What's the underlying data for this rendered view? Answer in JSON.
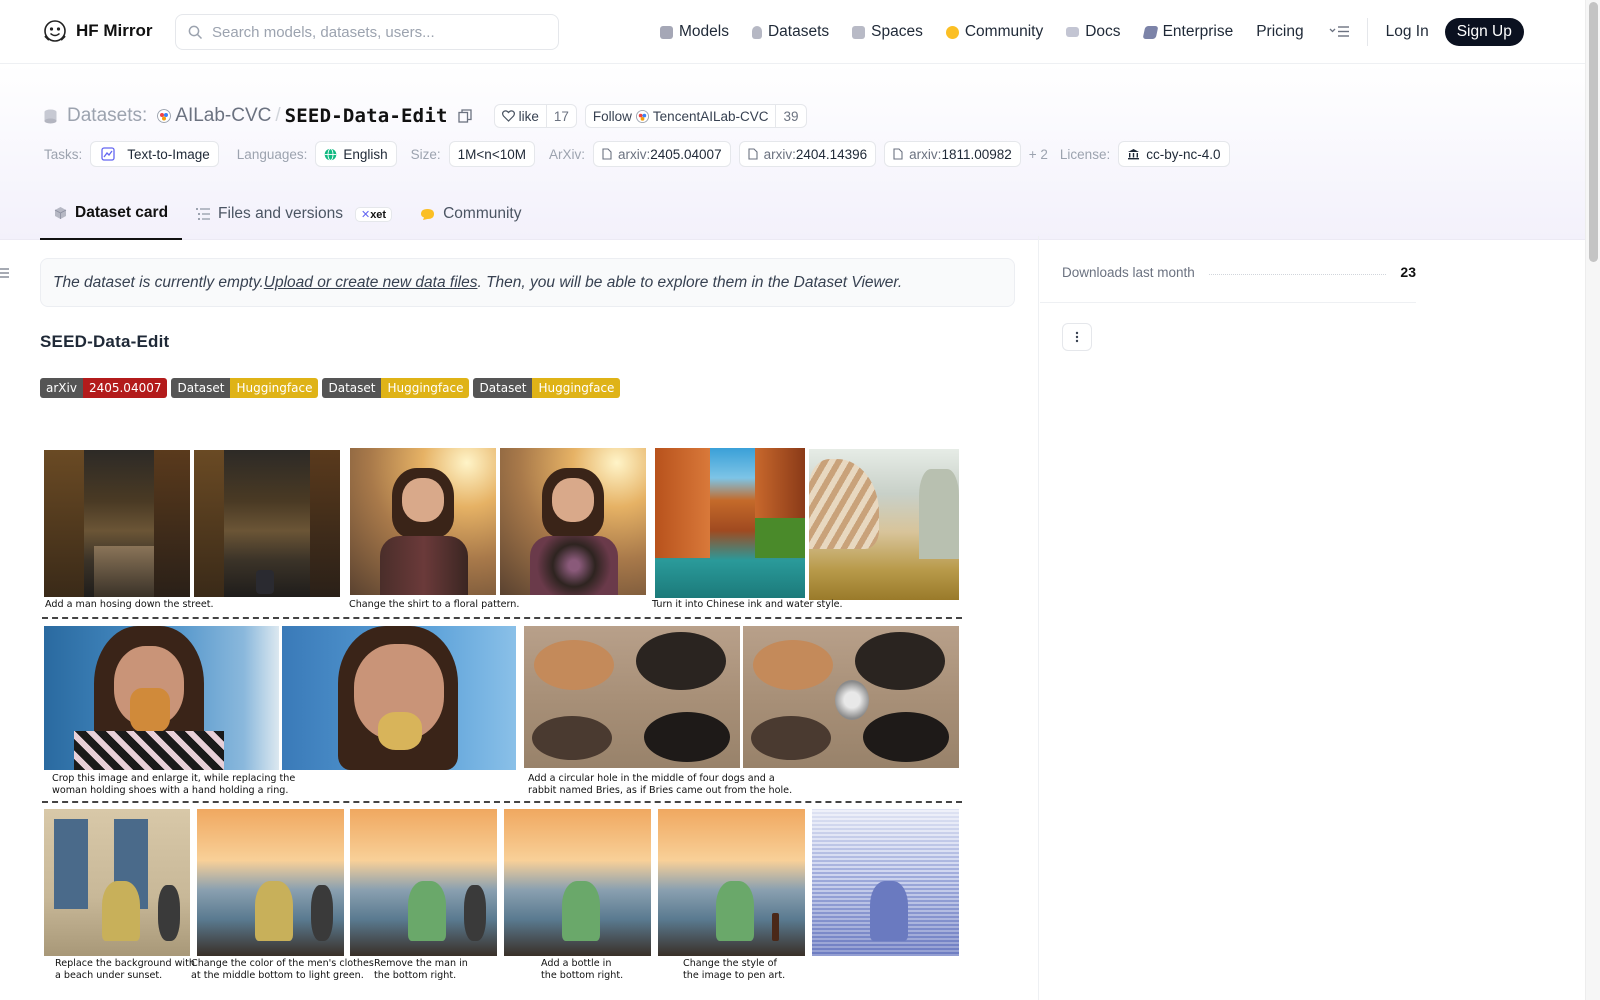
{
  "nav": {
    "brand": "HF Mirror",
    "search_placeholder": "Search models, datasets, users...",
    "links": [
      {
        "label": "Models",
        "icon": "models-icon",
        "color": "#a78bfa"
      },
      {
        "label": "Datasets",
        "icon": "datasets-icon",
        "color": "#f87171"
      },
      {
        "label": "Spaces",
        "icon": "spaces-icon",
        "color": "#60a5fa"
      },
      {
        "label": "Community",
        "icon": "community-icon",
        "color": "#fbbf24"
      },
      {
        "label": "Docs",
        "icon": "docs-icon",
        "color": "#a5b4fc"
      },
      {
        "label": "Enterprise",
        "icon": "enterprise-icon",
        "color": "#6366f1"
      },
      {
        "label": "Pricing",
        "icon": "",
        "color": ""
      }
    ],
    "login": "Log In",
    "signup": "Sign Up"
  },
  "header": {
    "datasets_label": "Datasets:",
    "org": "AILab-CVC",
    "repo": "SEED-Data-Edit",
    "like_label": "like",
    "like_count": "17",
    "follow_label": "Follow",
    "follow_org": "TencentAILab-CVC",
    "follow_count": "39"
  },
  "meta": {
    "tasks_label": "Tasks:",
    "task": "Text-to-Image",
    "languages_label": "Languages:",
    "language": "English",
    "size_label": "Size:",
    "size": "1M<n<10M",
    "arxiv_label": "ArXiv:",
    "arxiv": [
      {
        "prefix": "arxiv:",
        "id": "2405.04007"
      },
      {
        "prefix": "arxiv:",
        "id": "2404.14396"
      },
      {
        "prefix": "arxiv:",
        "id": "1811.00982"
      }
    ],
    "more": "+ 2",
    "license_label": "License:",
    "license": "cc-by-nc-4.0"
  },
  "tabs": [
    {
      "label": "Dataset card",
      "active": true
    },
    {
      "label": "Files and versions",
      "badge": "xet"
    },
    {
      "label": "Community"
    }
  ],
  "notice": {
    "prefix": "The dataset is currently empty. ",
    "link": "Upload or create new data files",
    "suffix": ". Then, you will be able to explore them in the Dataset Viewer."
  },
  "card": {
    "title": "SEED-Data-Edit",
    "badges": [
      {
        "left": "arXiv",
        "right": "2405.04007",
        "color": "#b31b1b"
      },
      {
        "left": "Dataset",
        "right": "Huggingface",
        "color": "#dfb317"
      },
      {
        "left": "Dataset",
        "right": "Huggingface",
        "color": "#dfb317"
      },
      {
        "left": "Dataset",
        "right": "Huggingface",
        "color": "#dfb317"
      }
    ],
    "captions": {
      "c1": "Add a man hosing down the street.",
      "c2": "Change the shirt to a floral pattern.",
      "c3": "Turn it into Chinese ink and water style.",
      "c4a": "Crop this image and enlarge it, while replacing the",
      "c4b": "woman holding shoes with a hand holding a ring.",
      "c5a": "Add a circular hole in the middle of four dogs and a",
      "c5b": "rabbit named Bries, as if Bries came out from the hole.",
      "c6a": "Replace the background with",
      "c6b": "a beach under sunset.",
      "c7a": "Change the color of the men's clothes",
      "c7b": "at the middle bottom to light green.",
      "c8a": "Remove the man in",
      "c8b": "the bottom right.",
      "c9a": "Add a bottle in",
      "c9b": "the bottom right.",
      "c10a": "Change the style of",
      "c10b": "the image to pen art."
    }
  },
  "sidebar": {
    "downloads_label": "Downloads last month",
    "downloads_value": "23"
  }
}
